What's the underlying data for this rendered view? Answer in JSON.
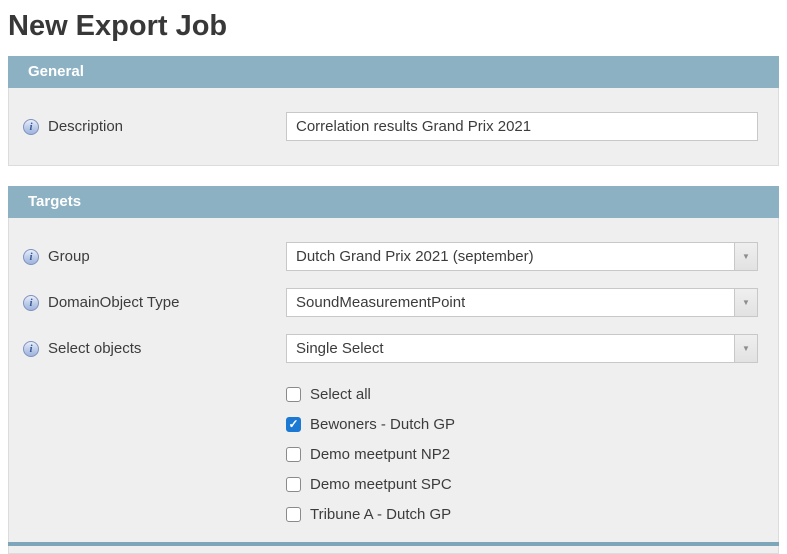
{
  "page_title": "New Export Job",
  "icons": {
    "info": "i",
    "dropdown_arrow": "▼",
    "check": "✓"
  },
  "colors": {
    "section_header_bg": "#8cb1c3",
    "checkbox_checked": "#1b79d4",
    "section_body_bg": "#efefef"
  },
  "sections": [
    {
      "title": "General",
      "fields": [
        {
          "label": "Description",
          "type": "text",
          "value": "Correlation results Grand Prix 2021"
        }
      ]
    },
    {
      "title": "Targets",
      "fields": [
        {
          "label": "Group",
          "type": "select",
          "value": "Dutch Grand Prix 2021 (september)"
        },
        {
          "label": "DomainObject Type",
          "type": "select",
          "value": "SoundMeasurementPoint"
        },
        {
          "label": "Select objects",
          "type": "select",
          "value": "Single Select"
        }
      ],
      "object_checkboxes": [
        {
          "label": "Select all",
          "checked": false
        },
        {
          "label": "Bewoners - Dutch GP",
          "checked": true
        },
        {
          "label": "Demo meetpunt NP2",
          "checked": false
        },
        {
          "label": "Demo meetpunt SPC",
          "checked": false
        },
        {
          "label": "Tribune A - Dutch GP",
          "checked": false
        }
      ]
    }
  ]
}
